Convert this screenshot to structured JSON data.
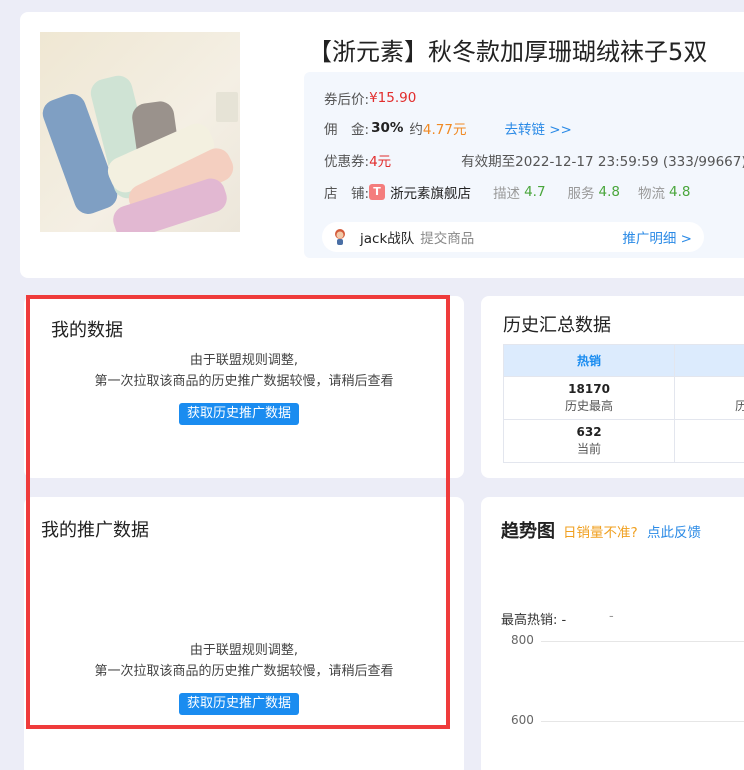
{
  "product": {
    "title": "【浙元素】秋冬款加厚珊瑚绒袜子5双",
    "price_label": "券后价:",
    "price": "¥15.90",
    "commission_label": "佣　金:",
    "commission_rate": "30%",
    "commission_approx_prefix": "约",
    "commission_amount": "4.77元",
    "convert_link": "去转链 >>",
    "coupon_label": "优惠券:",
    "coupon_value": "4元",
    "coupon_validity": "有效期至2022-12-17 23:59:59 (333/99667)",
    "shop_label": "店　铺:",
    "shop_badge": "T",
    "shop_name": "浙元素旗舰店",
    "ratings": [
      {
        "label": "描述",
        "value": "4.7"
      },
      {
        "label": "服务",
        "value": "4.8"
      },
      {
        "label": "物流",
        "value": "4.8"
      }
    ],
    "team_name": "jack战队",
    "team_action": "提交商品",
    "promo_detail": "推广明细 >"
  },
  "my_data": {
    "title": "我的数据",
    "notice_line1": "由于联盟规则调整,",
    "notice_line2": "第一次拉取该商品的历史推广数据较慢，请稍后查看",
    "button": "获取历史推广数据"
  },
  "my_promo": {
    "title": "我的推广数据",
    "notice_line1": "由于联盟规则调整,",
    "notice_line2": "第一次拉取该商品的历史推广数据较慢，请稍后查看",
    "button": "获取历史推广数据"
  },
  "history": {
    "title": "历史汇总数据",
    "header": "热销",
    "rows": [
      {
        "value": "18170",
        "label": "历史最高",
        "right_label": "历"
      },
      {
        "value": "632",
        "label": "当前",
        "right_label": ""
      }
    ]
  },
  "trend": {
    "title": "趋势图",
    "warning": "日销量不准?",
    "feedback": "点此反馈",
    "max_label": "最高热销:",
    "max_value": "-",
    "dash": "-",
    "y_ticks": [
      "800",
      "600"
    ]
  },
  "colors": {
    "accent": "#1a8cf0",
    "highlight": "#ef3b3b",
    "price": "#e22d2d"
  }
}
